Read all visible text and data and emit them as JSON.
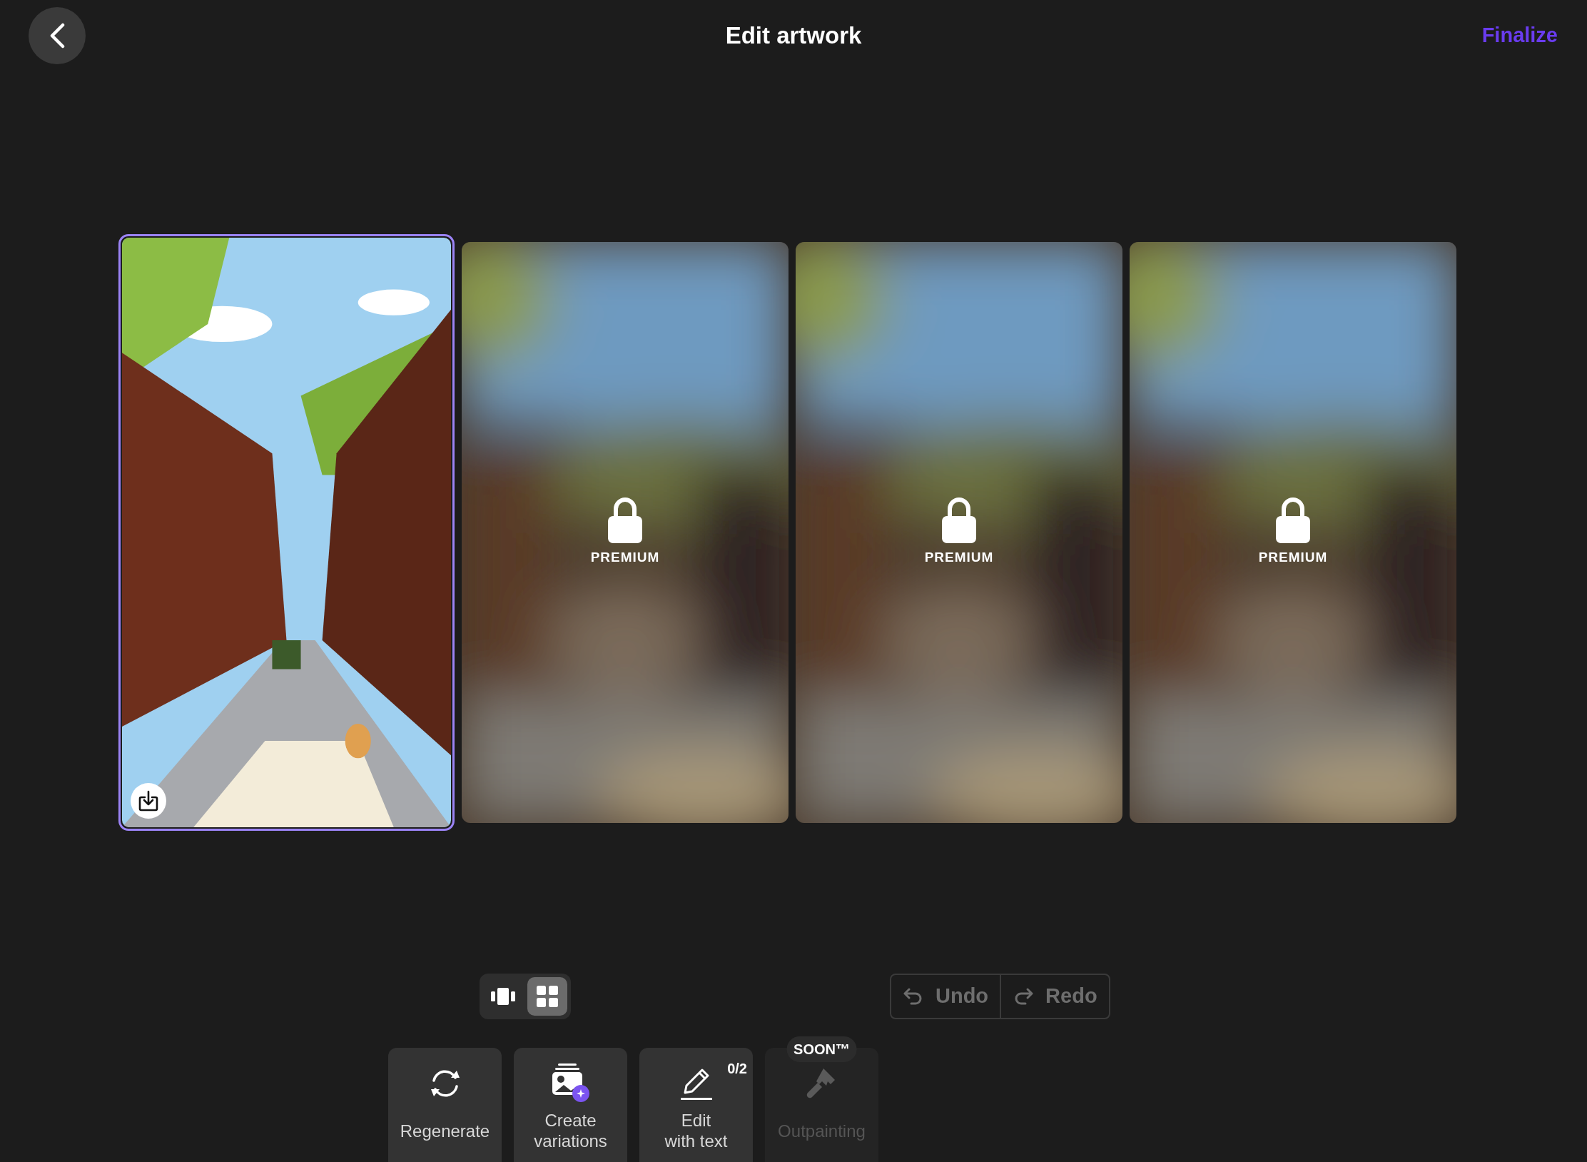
{
  "header": {
    "title": "Edit artwork",
    "action": "Finalize"
  },
  "artworks": [
    {
      "selected": true,
      "locked": false
    },
    {
      "selected": false,
      "locked": true,
      "badge": "PREMIUM"
    },
    {
      "selected": false,
      "locked": true,
      "badge": "PREMIUM"
    },
    {
      "selected": false,
      "locked": true,
      "badge": "PREMIUM"
    }
  ],
  "view_modes": [
    {
      "kind": "carousel",
      "selected": false
    },
    {
      "kind": "grid",
      "selected": true
    }
  ],
  "history": [
    {
      "kind": "undo",
      "label": "Undo",
      "disabled": true
    },
    {
      "kind": "redo",
      "label": "Redo",
      "disabled": true
    }
  ],
  "tools": [
    {
      "kind": "regenerate",
      "label": "Regenerate",
      "disabled": false
    },
    {
      "kind": "variations",
      "label": "Create\nvariations",
      "disabled": false
    },
    {
      "kind": "edit",
      "label": "Edit\nwith text",
      "disabled": false,
      "counter": "0/2"
    },
    {
      "kind": "outpaint",
      "label": "Outpainting",
      "disabled": true,
      "badge": "SOON™"
    }
  ]
}
